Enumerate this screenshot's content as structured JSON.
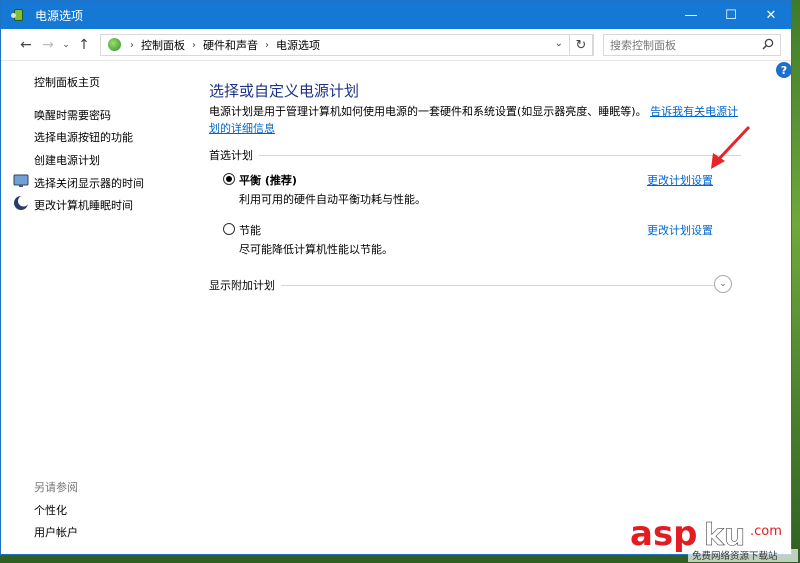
{
  "window": {
    "title": "电源选项",
    "controls": {
      "minimize": "—",
      "maximize": "☐",
      "close": "✕"
    }
  },
  "nav": {
    "breadcrumbs": [
      "控制面板",
      "硬件和声音",
      "电源选项"
    ],
    "search_placeholder": "搜索控制面板"
  },
  "sidebar": {
    "home": "控制面板主页",
    "items": [
      "唤醒时需要密码",
      "选择电源按钮的功能",
      "创建电源计划",
      "选择关闭显示器的时间",
      "更改计算机睡眠时间"
    ],
    "see_also_title": "另请参阅",
    "see_also": [
      "个性化",
      "用户帐户"
    ]
  },
  "main": {
    "heading": "选择或自定义电源计划",
    "description": "电源计划是用于管理计算机如何使用电源的一套硬件和系统设置(如显示器亮度、睡眠等)。",
    "description_link": "告诉我有关电源计划的详细信息",
    "preferred_section": "首选计划",
    "plans": [
      {
        "name": "平衡 (推荐)",
        "desc": "利用可用的硬件自动平衡功耗与性能。",
        "link": "更改计划设置",
        "selected": true
      },
      {
        "name": "节能",
        "desc": "尽可能降低计算机性能以节能。",
        "link": "更改计划设置",
        "selected": false
      }
    ],
    "additional_section": "显示附加计划"
  },
  "colors": {
    "titlebar": "#1478d4",
    "link": "#0066cc",
    "heading": "#1e3287",
    "annotation_arrow": "#e8242a"
  },
  "watermark": {
    "brand": "asp",
    "sub": "免费网络资源下载站"
  }
}
